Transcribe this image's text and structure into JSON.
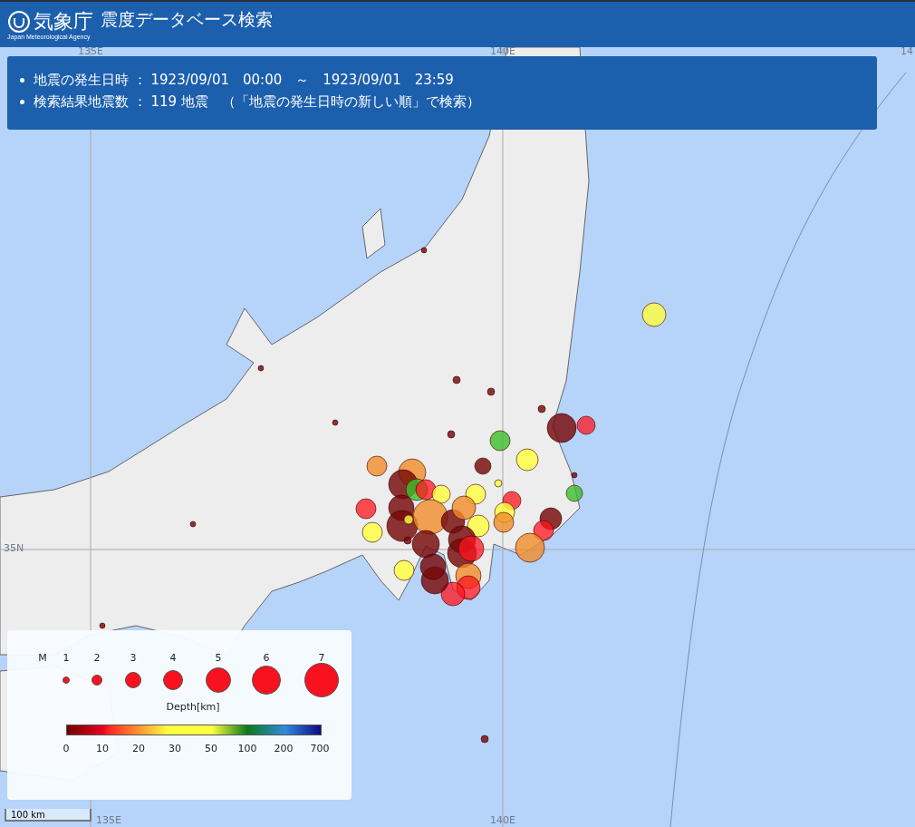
{
  "header": {
    "agency_name": "気象庁",
    "agency_name_en": "Japan Meteorological Agency",
    "title": "震度データベース検索"
  },
  "search_summary": [
    "地震の発生日時 ： 1923/09/01　00:00　～　1923/09/01　23:59",
    "検索結果地震数 ： 119 地震　（「地震の発生日時の新しい順」で検索）"
  ],
  "grid_labels": [
    "135E",
    "140E",
    "14",
    "35N",
    "135E",
    "140E"
  ],
  "legend": {
    "magnitude_label": "M",
    "magnitudes": [
      "1",
      "2",
      "3",
      "4",
      "5",
      "6",
      "7"
    ],
    "depth_title": "Depth[km]",
    "depth_ticks": [
      "0",
      "10",
      "20",
      "30",
      "50",
      "100",
      "200",
      "700"
    ]
  },
  "scale_bar": "100 km"
}
